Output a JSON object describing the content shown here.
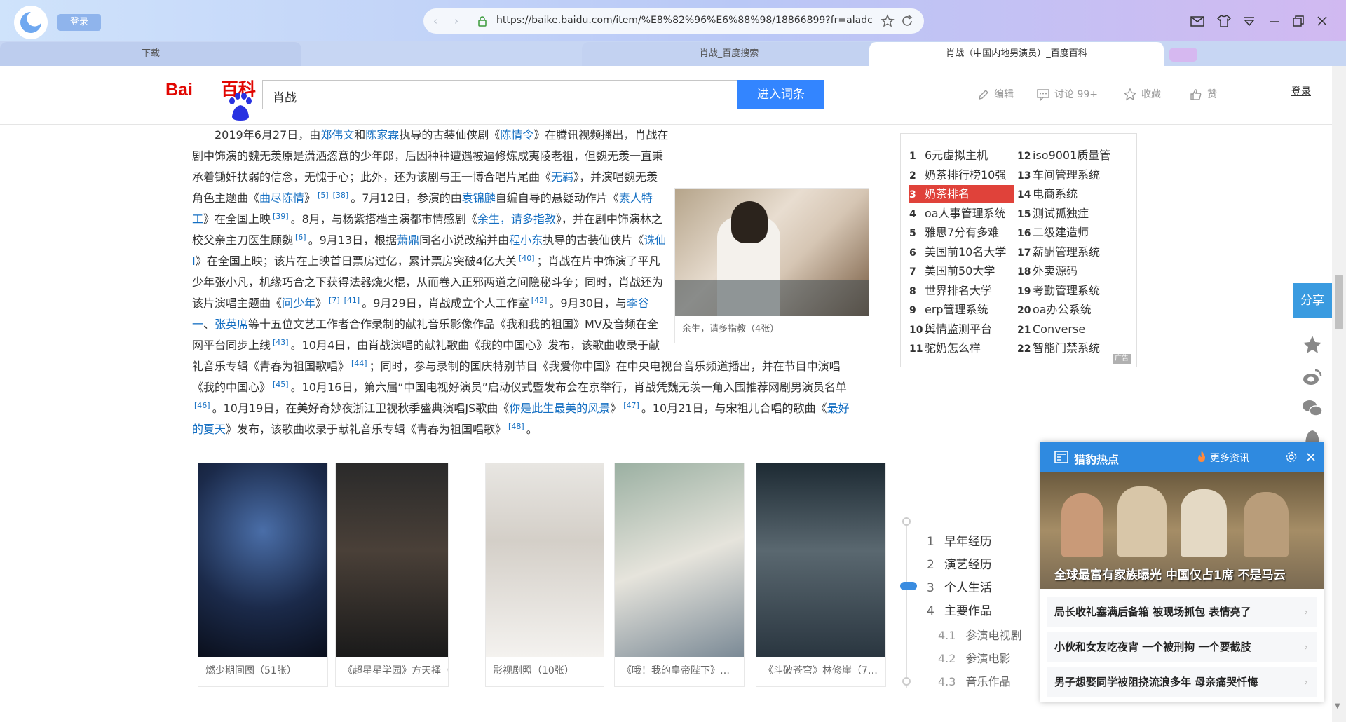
{
  "browser": {
    "login_label": "登录",
    "url": "https://baike.baidu.com/item/%E8%82%96%E6%88%98/18866899?fr=aladc",
    "tabs": [
      {
        "label": "下载"
      },
      {
        "label": "肖战_百度搜索"
      },
      {
        "label": "肖战（中国内地男演员）_百度百科"
      }
    ]
  },
  "header": {
    "logo_bai": "Bai",
    "logo_du": "du",
    "logo_baike": "百科",
    "search_value": "肖战",
    "search_button": "进入词条",
    "tools": {
      "edit": "编辑",
      "discuss": "讨论 99+",
      "collect": "收藏",
      "like": "赞"
    },
    "login": "登录"
  },
  "article": {
    "p1": "2019年6月27日，由",
    "l1": "郑伟文",
    "p2": "和",
    "l2": "陈家霖",
    "p3": "执导的古装仙侠剧《",
    "l3": "陈情令",
    "p4": "》在腾讯视频播出，肖战在剧中饰演的魏无羡原是潇洒恣意的少年郎，后因种种遭遇被逼修炼成夷陵老祖，但魏无羡一直秉承着锄奸扶弱的信念，无愧于心；此外，还为该剧与王一博合唱片尾曲《",
    "l4": "无羁",
    "p5": "》，并演唱魏无羡角色主题曲《",
    "l5": "曲尽陈情",
    "p6": "》",
    "s1": "[5]",
    "s2": "[38]",
    "p7": "。7月12日，参演的由",
    "l6": "袁锦麟",
    "p8": "自编自导的悬疑动作片《",
    "l7": "素人特工",
    "p9": "》在全国上映",
    "s3": "[39]",
    "p10": "。8月，与杨紫搭档主演都市情感剧《",
    "l8": "余生，请多指教",
    "p11": "》，并在剧中饰演林之校父亲主刀医生顾魏",
    "s4": "[6]",
    "p12": "。9月13日，根据",
    "l9": "萧鼎",
    "p13": "同名小说改编并由",
    "l10": "程小东",
    "p14": "执导的古装仙侠片《",
    "l11": "诛仙Ⅰ",
    "p15": "》在全国上映；该片在上映首日票房过亿，累计票房突破4亿大关",
    "s5": "[40]",
    "p16": "；肖战在片中饰演了平凡少年张小凡，机缘巧合之下获得法器烧火棍，从而卷入正邪两道之间隐秘斗争；同时，肖战还为该片演唱主题曲《",
    "l12": "问少年",
    "p17": "》",
    "s6": "[7]",
    "s7": "[41]",
    "p18": "。9月29日，肖战成立个人工作室",
    "s8": "[42]",
    "p19": "。9月30日，与",
    "l13": "李谷一",
    "p20": "、",
    "l14": "张英席",
    "p21": "等十五位文艺工作者合作录制的献礼音乐影像作品《我和我的祖国》MV及音频在全网平台同步上线",
    "s9": "[43]",
    "p22": "。10月4日，由肖战演唱的献礼歌曲《我的中国心》发布，该歌曲收录于献礼音乐专辑《青春为祖国歌唱》",
    "s10": "[44]",
    "p23": "；同时，参与录制的国庆特别节目《我爱你中国》在中央电视台音乐频道播出，并在节目中演唱《我的中国心》",
    "s11": "[45]",
    "p24": "。10月16日，第六届“中国电视好演员”启动仪式暨发布会在京举行，肖战凭魏无羡一角入围推荐网剧男演员名单",
    "s12": "[46]",
    "p25": "。10月19日，在美好奇妙夜浙江卫视秋季盛典演唱JS歌曲《",
    "l15": "你是此生最美的风景",
    "p26": "》",
    "s13": "[47]",
    "p27": "。10月21日，与宋祖儿合唱的歌曲《",
    "l16": "最好的夏天",
    "p28": "》发布，该歌曲收录于献礼音乐专辑《青春为祖国唱歌》",
    "s14": "[48]",
    "p29": "。",
    "float_caption": "余生，请多指教（4张）"
  },
  "gallery": [
    {
      "caption": "燃少期间图（51张）"
    },
    {
      "caption": "《超星星学园》方天择（…"
    },
    {
      "caption": "影视剧照（10张）"
    },
    {
      "caption": "《哦！我的皇帝陛下》…"
    },
    {
      "caption": "《斗破苍穹》林修崖（7…"
    }
  ],
  "ranking": {
    "left": [
      {
        "n": "1",
        "t": "6元虚拟主机"
      },
      {
        "n": "2",
        "t": "奶茶排行榜10强"
      },
      {
        "n": "3",
        "t": "奶茶排名"
      },
      {
        "n": "4",
        "t": "oa人事管理系统"
      },
      {
        "n": "5",
        "t": "雅思7分有多难"
      },
      {
        "n": "6",
        "t": "美国前10名大学"
      },
      {
        "n": "7",
        "t": "美国前50大学"
      },
      {
        "n": "8",
        "t": "世界排名大学"
      },
      {
        "n": "9",
        "t": "erp管理系统"
      },
      {
        "n": "10",
        "t": "舆情监测平台"
      },
      {
        "n": "11",
        "t": "驼奶怎么样"
      }
    ],
    "right": [
      {
        "n": "12",
        "t": "iso9001质量管"
      },
      {
        "n": "13",
        "t": "车间管理系统"
      },
      {
        "n": "14",
        "t": "电商系统"
      },
      {
        "n": "15",
        "t": "测试孤独症"
      },
      {
        "n": "16",
        "t": "二级建造师"
      },
      {
        "n": "17",
        "t": "薪酬管理系统"
      },
      {
        "n": "18",
        "t": "外卖源码"
      },
      {
        "n": "19",
        "t": "考勤管理系统"
      },
      {
        "n": "20",
        "t": "oa办公系统"
      },
      {
        "n": "21",
        "t": "Converse"
      },
      {
        "n": "22",
        "t": "智能门禁系统"
      }
    ],
    "ad_label": "广告"
  },
  "catalog": {
    "items": [
      {
        "n": "1",
        "t": "早年经历"
      },
      {
        "n": "2",
        "t": "演艺经历"
      },
      {
        "n": "3",
        "t": "个人生活"
      },
      {
        "n": "4",
        "t": "主要作品"
      }
    ],
    "subs": [
      {
        "n": "4.1",
        "t": "参演电视剧"
      },
      {
        "n": "4.2",
        "t": "参演电影"
      },
      {
        "n": "4.3",
        "t": "音乐作品"
      }
    ]
  },
  "share": {
    "label": "分享"
  },
  "popup": {
    "title": "猎豹热点",
    "more": "更多资讯",
    "headline": "全球最富有家族曝光 中国仅占1席 不是马云",
    "news": [
      {
        "t": "局长收礼塞满后备箱 被现场抓包 表情亮了"
      },
      {
        "t": "小伙和女友吃夜宵 一个被刑拘 一个要截肢"
      },
      {
        "t": "男子想娶同学被阻挠流浪多年 母亲痛哭忏悔"
      }
    ]
  },
  "colors": {
    "accent": "#3385ff",
    "link": "#136ec2",
    "highlight": "#e0423a",
    "popup": "#2f8ae0"
  }
}
